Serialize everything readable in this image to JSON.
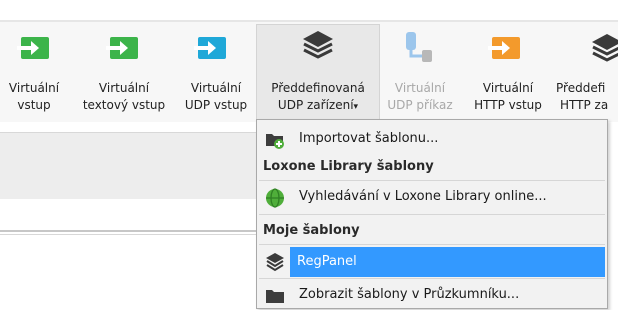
{
  "ribbon": {
    "buttons": [
      {
        "line1": "Virtuální",
        "line2": "vstup",
        "icon": "green-arrow-in-icon",
        "color": "#3cb44a"
      },
      {
        "line1": "Virtuální",
        "line2": "textový vstup",
        "icon": "green-arrow-in-icon",
        "color": "#3cb44a"
      },
      {
        "line1": "Virtuální",
        "line2": "UDP vstup",
        "icon": "cyan-arrow-in-icon",
        "color": "#1fa8d8"
      },
      {
        "line1": "Předdefinovaná",
        "line2": "UDP zařízení",
        "caret": "▾",
        "icon": "layers-icon",
        "color": "#3a3a3a"
      },
      {
        "line1": "Virtuální",
        "line2": "UDP příkaz",
        "icon": "command-icon",
        "color": "#9cc6ec"
      },
      {
        "line1": "Virtuální",
        "line2": "HTTP vstup",
        "icon": "orange-arrow-in-icon",
        "color": "#f39a2c"
      },
      {
        "line1": "Předdefi",
        "line2": "HTTP za",
        "icon": "layers-icon",
        "color": "#3a3a3a"
      }
    ]
  },
  "menu": {
    "import": "Importovat šablonu...",
    "library_header": "Loxone Library šablony",
    "search_online": "Vyhledávání v Loxone Library online...",
    "my_templates_header": "Moje šablony",
    "template_item": "RegPanel",
    "show_in_explorer": "Zobrazit šablony v Průzkumníku..."
  },
  "colors": {
    "selection": "#3399ff",
    "globe": "#4fae3a",
    "folder": "#3d3d3d"
  }
}
